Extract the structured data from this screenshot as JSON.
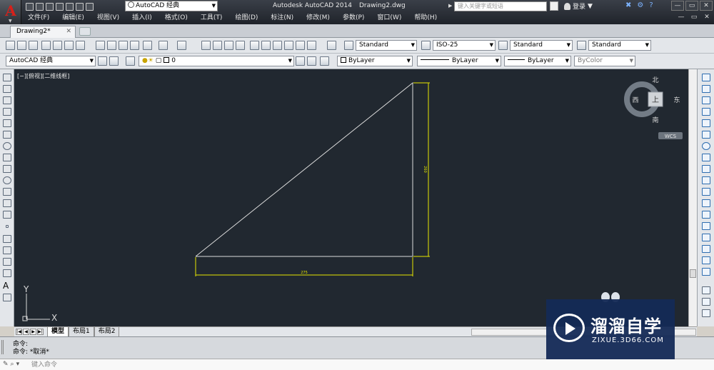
{
  "titlebar": {
    "workspace": "AutoCAD 经典",
    "app_title": "Autodesk AutoCAD 2014",
    "doc_title": "Drawing2.dwg",
    "search_placeholder": "键入关键字或短语",
    "login": "登录",
    "win_controls": [
      "—",
      "▭",
      "✕"
    ]
  },
  "menu": [
    "文件(F)",
    "编辑(E)",
    "视图(V)",
    "插入(I)",
    "格式(O)",
    "工具(T)",
    "绘图(D)",
    "标注(N)",
    "修改(M)",
    "参数(P)",
    "窗口(W)",
    "帮助(H)"
  ],
  "mdi_controls": [
    "—",
    "▭",
    "✕"
  ],
  "doc_tab": {
    "label": "Drawing2*",
    "close": "✕"
  },
  "toolbar1": {
    "text_style": "Standard",
    "dim_style": "ISO-25",
    "table_style": "Standard",
    "mleader_style": "Standard"
  },
  "toolbar2": {
    "workspace": "AutoCAD 经典",
    "layer": "0",
    "color": "ByLayer",
    "linetype": "ByLayer",
    "lineweight": "ByLayer",
    "plotstyle": "ByColor"
  },
  "viewport": {
    "label": "[−][俯视][二维线框]",
    "viewcube": {
      "n": "北",
      "s": "南",
      "e": "东",
      "w": "西",
      "top": "上",
      "wcs": "WCS"
    },
    "ucs": {
      "x": "X",
      "y": "Y"
    },
    "dim_horizontal": "275",
    "dim_vertical": "260"
  },
  "layout_tabs": [
    "模型",
    "布局1",
    "布局2"
  ],
  "command": {
    "history": [
      "命令:",
      "命令: *取消*"
    ],
    "placeholder": "键入命令"
  },
  "watermark": {
    "cn": "溜溜自学",
    "en": "ZIXUE.3D66.COM"
  },
  "colors": {
    "canvas": "#212830",
    "geometry": "#dcdcdc",
    "dimension": "#e6e600",
    "titlebar": "#2a2e35"
  }
}
